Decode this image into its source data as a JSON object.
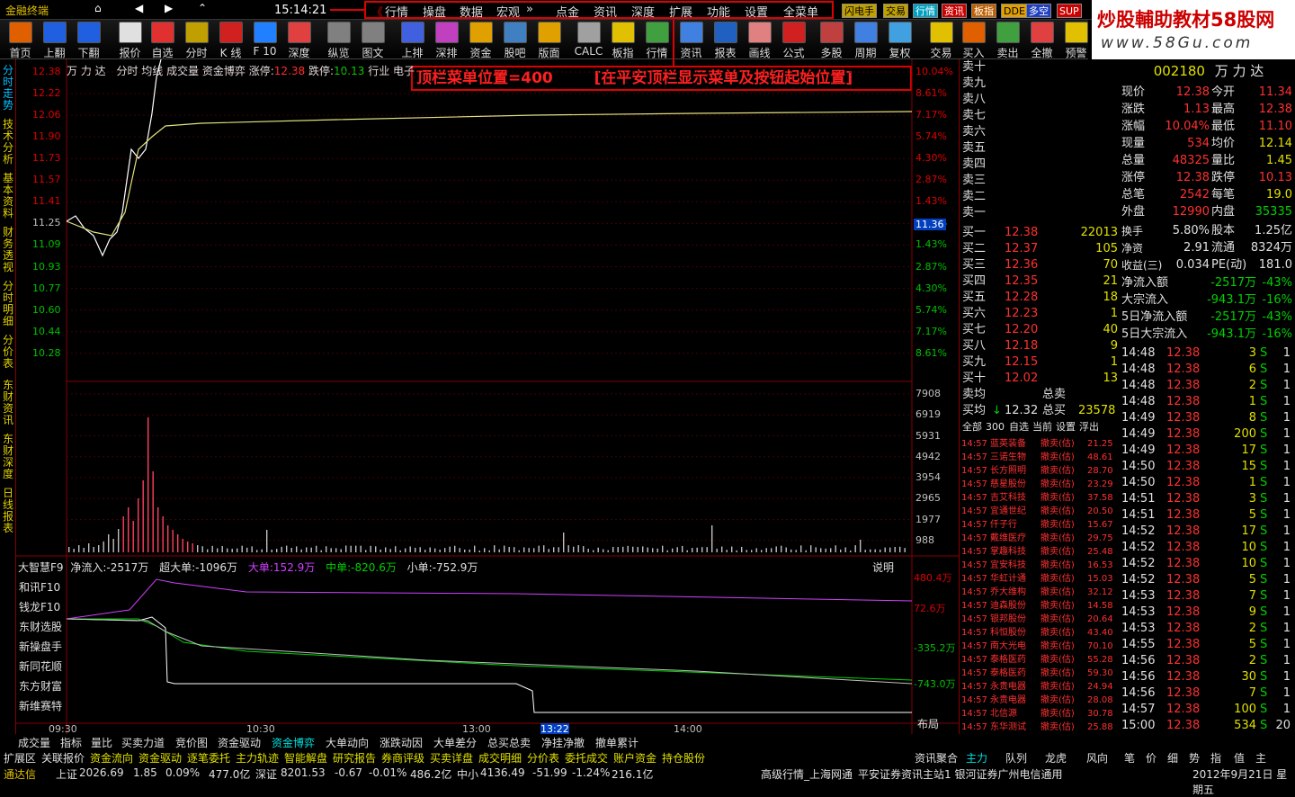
{
  "title": {
    "app": "金融终端",
    "time": "15:14:21",
    "watermark": "炒股輔助教材58股网",
    "watermark_url": "www.58Gu.com"
  },
  "menus": [
    "行情",
    "操盘",
    "数据",
    "宏观",
    "点金",
    "资讯",
    "深度",
    "扩展",
    "功能",
    "设置",
    "全菜单"
  ],
  "tags": [
    "闪电手",
    "交易",
    "行情",
    "资讯",
    "板指",
    "DDE",
    "多空",
    "SUP"
  ],
  "toolbar": [
    "首页",
    "上翻",
    "下翻",
    "报价",
    "自选",
    "分时",
    "K 线",
    "F 10",
    "深度",
    "纵览",
    "图文",
    "上排",
    "深排",
    "资金",
    "股吧",
    "版面",
    "CALC",
    "板指",
    "行情",
    "资讯",
    "报表",
    "画线",
    "公式",
    "多股",
    "周期",
    "复权",
    "交易",
    "买入",
    "卖出",
    "全撤",
    "预警"
  ],
  "annotation": {
    "left": "顶栏菜单位置=400",
    "right": "[在平安顶栏显示菜单及按钮起始位置]"
  },
  "stock": {
    "name": "万 力 达",
    "code": "002180",
    "name2": "万 力 达",
    "header": "分时 均线 成交量 资金博弈",
    "zt_label": "涨停:",
    "zt": "12.38",
    "dt_label": "跌停:",
    "dt": "10.13",
    "ind": "行业 电子"
  },
  "price_axis": [
    "12.38",
    "12.22",
    "12.06",
    "11.90",
    "11.73",
    "11.57",
    "11.41",
    "11.25",
    "11.09",
    "10.93",
    "10.77",
    "10.60",
    "10.44",
    "10.28"
  ],
  "pct_axis": [
    "10.04%",
    "8.61%",
    "7.17%",
    "5.74%",
    "4.30%",
    "2.87%",
    "1.43%",
    "0.00%",
    "1.43%",
    "2.87%",
    "4.30%",
    "5.74%",
    "7.17%",
    "8.61%"
  ],
  "vol_axis": [
    "7908",
    "6919",
    "5931",
    "4942",
    "3954",
    "2965",
    "1977",
    "988"
  ],
  "cur_price": "11.36",
  "flow": {
    "label": "净流入:-2517万",
    "super": "超大单:-1096万",
    "big": "大单:152.9万",
    "mid": "中单:-820.6万",
    "small": "小单:-752.9万",
    "help": "说明",
    "axis": [
      "480.4万",
      "72.6万",
      "-335.2万",
      "-743.0万"
    ]
  },
  "f10": [
    "大智慧F9",
    "和讯F10",
    "钱龙F10",
    "东财选股",
    "新操盘手",
    "新同花顺",
    "东方财富",
    "新维赛特"
  ],
  "time_axis": [
    "09:30",
    "10:30",
    "13:00",
    "13:22",
    "14:00"
  ],
  "layout_btn": "布局",
  "leftnav": [
    "分时走势",
    "技术分析",
    "基本资料",
    "财务透视",
    "分时明细",
    "分价表",
    "东财资讯",
    "东财深度",
    "日线报表"
  ],
  "sells": [
    "卖十",
    "卖九",
    "卖八",
    "卖七",
    "卖六",
    "卖五",
    "卖四",
    "卖三",
    "卖二",
    "卖一"
  ],
  "buys": [
    {
      "l": "买一",
      "p": "12.38",
      "v": "22013"
    },
    {
      "l": "买二",
      "p": "12.37",
      "v": "105"
    },
    {
      "l": "买三",
      "p": "12.36",
      "v": "70"
    },
    {
      "l": "买四",
      "p": "12.35",
      "v": "21"
    },
    {
      "l": "买五",
      "p": "12.28",
      "v": "18"
    },
    {
      "l": "买六",
      "p": "12.23",
      "v": "1"
    },
    {
      "l": "买七",
      "p": "12.20",
      "v": "40"
    },
    {
      "l": "买八",
      "p": "12.18",
      "v": "9"
    },
    {
      "l": "买九",
      "p": "12.15",
      "v": "1"
    },
    {
      "l": "买十",
      "p": "12.02",
      "v": "13"
    }
  ],
  "avg": {
    "sell_avg": "卖均",
    "total_sell": "总卖",
    "buy_avg": "买均",
    "buy_avg_v": "12.32",
    "total_buy": "总买",
    "total_buy_v": "23578"
  },
  "quote": [
    [
      "现价",
      "12.38",
      "今开",
      "11.34"
    ],
    [
      "涨跌",
      "1.13",
      "最高",
      "12.38"
    ],
    [
      "涨幅",
      "10.04%",
      "最低",
      "11.10"
    ],
    [
      "现量",
      "534",
      "均价",
      "12.14"
    ],
    [
      "总量",
      "48325",
      "量比",
      "1.45"
    ],
    [
      "涨停",
      "12.38",
      "跌停",
      "10.13"
    ],
    [
      "总笔",
      "2542",
      "每笔",
      "19.0"
    ],
    [
      "外盘",
      "12990",
      "内盘",
      "35335"
    ]
  ],
  "quote2": [
    [
      "换手",
      "5.80%",
      "股本",
      "1.25亿"
    ],
    [
      "净资",
      "2.91",
      "流通",
      "8324万"
    ],
    [
      "收益(三)",
      "0.034",
      "PE(动)",
      "181.0"
    ]
  ],
  "flows": [
    [
      "净流入额",
      "-2517万",
      "-43%"
    ],
    [
      "大宗流入",
      "-943.1万",
      "-16%"
    ],
    [
      "5日净流入额",
      "-2517万",
      "-43%"
    ],
    [
      "5日大宗流入",
      "-943.1万",
      "-16%"
    ]
  ],
  "ticks": [
    [
      "14:48",
      "12.38",
      "3",
      "S",
      "1"
    ],
    [
      "14:48",
      "12.38",
      "6",
      "S",
      "1"
    ],
    [
      "14:48",
      "12.38",
      "2",
      "S",
      "1"
    ],
    [
      "14:48",
      "12.38",
      "1",
      "S",
      "1"
    ],
    [
      "14:49",
      "12.38",
      "8",
      "S",
      "1"
    ],
    [
      "14:49",
      "12.38",
      "200",
      "S",
      "1"
    ],
    [
      "14:49",
      "12.38",
      "17",
      "S",
      "1"
    ],
    [
      "14:50",
      "12.38",
      "15",
      "S",
      "1"
    ],
    [
      "14:50",
      "12.38",
      "1",
      "S",
      "1"
    ],
    [
      "14:51",
      "12.38",
      "3",
      "S",
      "1"
    ],
    [
      "14:51",
      "12.38",
      "5",
      "S",
      "1"
    ],
    [
      "14:52",
      "12.38",
      "17",
      "S",
      "1"
    ],
    [
      "14:52",
      "12.38",
      "10",
      "S",
      "1"
    ],
    [
      "14:52",
      "12.38",
      "10",
      "S",
      "1"
    ],
    [
      "14:52",
      "12.38",
      "5",
      "S",
      "1"
    ],
    [
      "14:53",
      "12.38",
      "7",
      "S",
      "1"
    ],
    [
      "14:53",
      "12.38",
      "9",
      "S",
      "1"
    ],
    [
      "14:53",
      "12.38",
      "2",
      "S",
      "1"
    ],
    [
      "14:55",
      "12.38",
      "5",
      "S",
      "1"
    ],
    [
      "14:56",
      "12.38",
      "2",
      "S",
      "1"
    ],
    [
      "14:56",
      "12.38",
      "30",
      "S",
      "1"
    ],
    [
      "14:56",
      "12.38",
      "7",
      "S",
      "1"
    ],
    [
      "14:57",
      "12.38",
      "100",
      "S",
      "1"
    ],
    [
      "15:00",
      "12.38",
      "534",
      "S",
      "20"
    ]
  ],
  "news_tabs": [
    "全部",
    "300",
    "自选",
    "当前",
    "设置",
    "浮出"
  ],
  "news": [
    [
      "14:57",
      "蓝英装备",
      "撤卖(估)",
      "21.25"
    ],
    [
      "14:57",
      "三诺生物",
      "撤卖(估)",
      "48.61"
    ],
    [
      "14:57",
      "长方照明",
      "撤卖(估)",
      "28.70"
    ],
    [
      "14:57",
      "慈星股份",
      "撤卖(估)",
      "23.29"
    ],
    [
      "14:57",
      "吉艾科技",
      "撤卖(估)",
      "37.58"
    ],
    [
      "14:57",
      "宜通世纪",
      "撤卖(估)",
      "20.50"
    ],
    [
      "14:57",
      "仟子行",
      "撤卖(估)",
      "15.67"
    ],
    [
      "14:57",
      "戴维医疗",
      "撤卖(估)",
      "29.75"
    ],
    [
      "14:57",
      "掌趣科技",
      "撤卖(估)",
      "25.48"
    ],
    [
      "14:57",
      "宜安科技",
      "撤卖(估)",
      "16.53"
    ],
    [
      "14:57",
      "华虹计通",
      "撤卖(估)",
      "15.03"
    ],
    [
      "14:57",
      "乔大维构",
      "撤卖(估)",
      "32.12"
    ],
    [
      "14:57",
      "迪森股份",
      "撤卖(估)",
      "14.58"
    ],
    [
      "14:57",
      "银邦股份",
      "撤卖(估)",
      "20.64"
    ],
    [
      "14:57",
      "科恒股份",
      "撤卖(估)",
      "43.40"
    ],
    [
      "14:57",
      "南大光电",
      "撤卖(估)",
      "70.10"
    ],
    [
      "14:57",
      "泰格医药",
      "撤卖(估)",
      "55.28"
    ],
    [
      "14:57",
      "泰格医药",
      "撤卖(估)",
      "59.30"
    ],
    [
      "14:57",
      "永贵电器",
      "撤卖(估)",
      "24.94"
    ],
    [
      "14:57",
      "永贵电器",
      "撤卖(估)",
      "28.08"
    ],
    [
      "14:57",
      "北信源",
      "撤卖(估)",
      "30.78"
    ],
    [
      "14:57",
      "东华测试",
      "撤卖(估)",
      "25.88"
    ],
    [
      "14:57",
      "宋华测试",
      "撤卖(估)",
      "29.34"
    ]
  ],
  "bottom_tabs1": [
    "成交量",
    "指标",
    "量比",
    "买卖力道",
    "竞价图",
    "资金驱动",
    "资金博弈",
    "大单动向",
    "涨跌动因",
    "大单差分",
    "总买总卖",
    "净挂净撤",
    "撤单累计"
  ],
  "bottom_tabs2": [
    "扩展区",
    "关联报价",
    "资金流向",
    "资金驱动",
    "逐笔委托",
    "主力轨迹",
    "智能解盘",
    "研究报告",
    "券商评级",
    "买卖详盘",
    "成交明细",
    "分价表",
    "委托成交",
    "账户资金",
    "持仓股份"
  ],
  "right_tabs": [
    "资讯聚合",
    "主力",
    "队列",
    "龙虎",
    "风向",
    "笔",
    "价",
    "细",
    "势",
    "指",
    "值",
    "主"
  ],
  "status": {
    "app": "通达信",
    "sh": "上证",
    "sh_v": "2026.69",
    "sh_c": "1.85",
    "sh_p": "0.09%",
    "sh_a": "477.0亿",
    "sz": "深证",
    "sz_v": "8201.53",
    "sz_c": "-0.67",
    "sz_p": "-0.01%",
    "sz_a": "486.2亿",
    "zx": "中小",
    "zx_v": "4136.49",
    "zx_c": "-51.99",
    "zx_p": "-1.24%",
    "zx_a": "216.1亿",
    "net": "高级行情_上海网通",
    "msg": "平安证券资讯主站1 银河证券广州电信通用",
    "date": "2012年9月21日 星期五"
  }
}
